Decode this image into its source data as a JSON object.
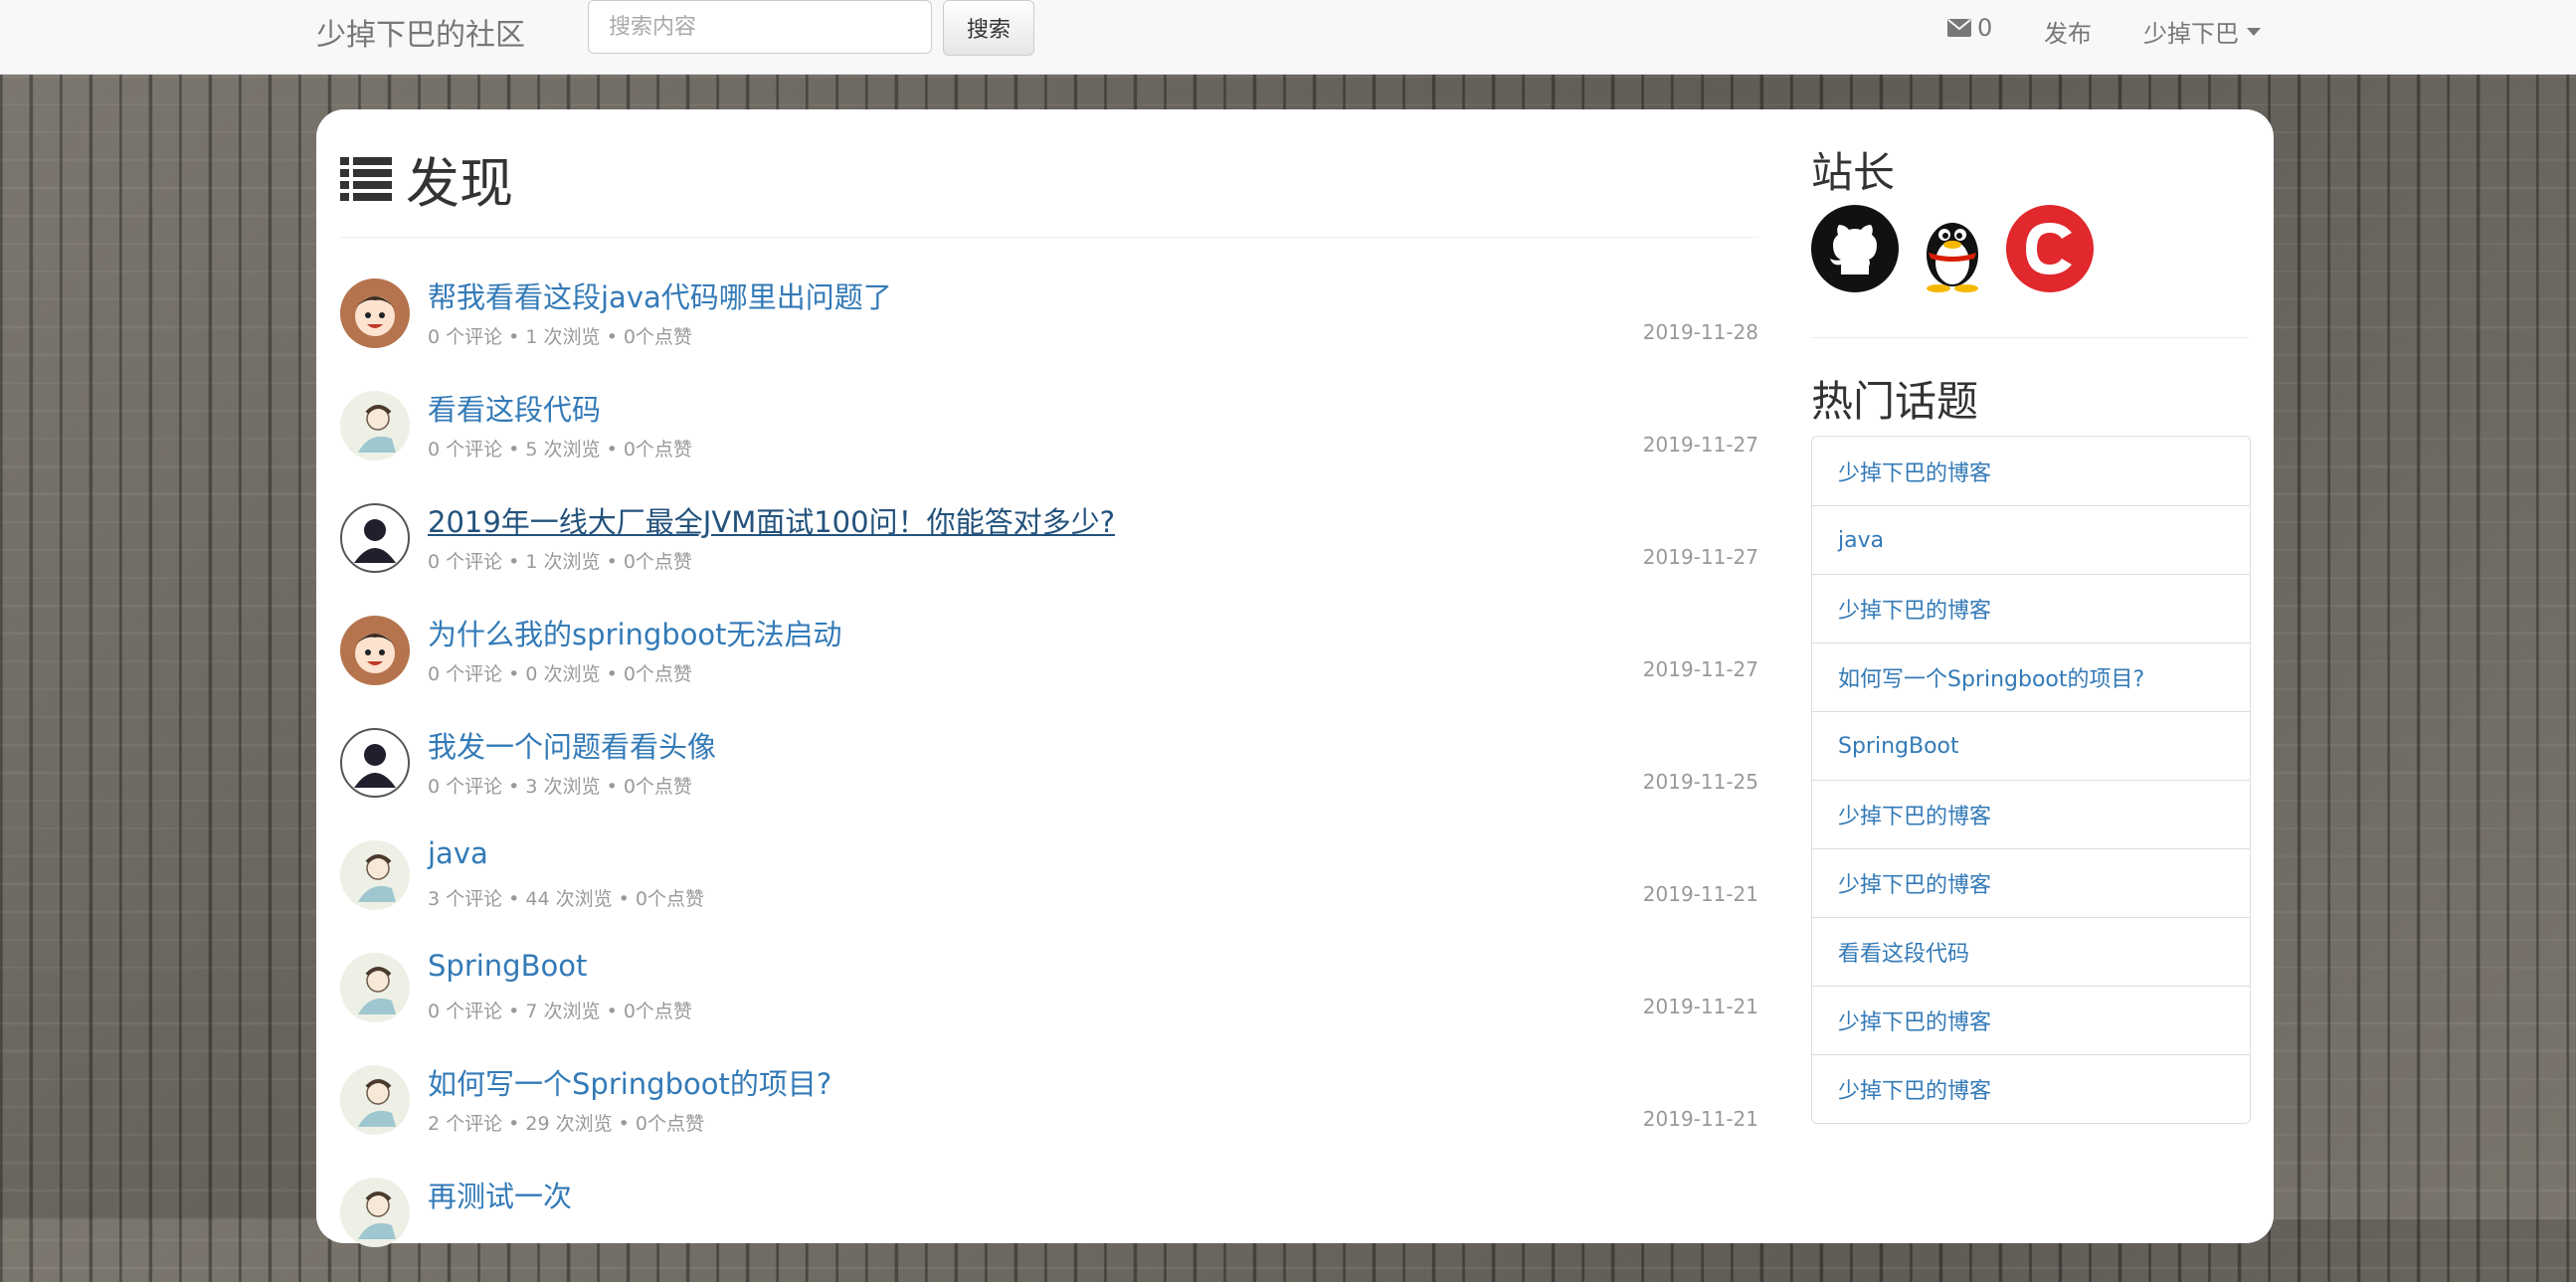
{
  "navbar": {
    "brand": "少掉下巴的社区",
    "search_placeholder": "搜索内容",
    "search_button": "搜索",
    "message_count": "0",
    "publish": "发布",
    "user": "少掉下巴"
  },
  "main": {
    "title": "发现",
    "questions": [
      {
        "title": "帮我看看这段java代码哪里出问题了",
        "meta": "0 个评论 • 1 次浏览 • 0个点赞",
        "date": "2019-11-28",
        "avatar": "cartoon-boy-avatar"
      },
      {
        "title": "看看这段代码",
        "meta": "0 个评论 • 5 次浏览 • 0个点赞",
        "date": "2019-11-27",
        "avatar": "sketch-person-avatar"
      },
      {
        "title": "2019年一线大厂最全JVM面试100问！你能答对多少?",
        "meta": "0 个评论 • 1 次浏览 • 0个点赞",
        "date": "2019-11-27",
        "avatar": "default-user-avatar"
      },
      {
        "title": "为什么我的springboot无法启动",
        "meta": "0 个评论 • 0 次浏览 • 0个点赞",
        "date": "2019-11-27",
        "avatar": "cartoon-boy-avatar"
      },
      {
        "title": "我发一个问题看看头像",
        "meta": "0 个评论 • 3 次浏览 • 0个点赞",
        "date": "2019-11-25",
        "avatar": "default-user-avatar"
      },
      {
        "title": "java",
        "meta": "3 个评论 • 44 次浏览 • 0个点赞",
        "date": "2019-11-21",
        "avatar": "sketch-person-avatar"
      },
      {
        "title": "SpringBoot",
        "meta": "0 个评论 • 7 次浏览 • 0个点赞",
        "date": "2019-11-21",
        "avatar": "sketch-person-avatar"
      },
      {
        "title": "如何写一个Springboot的项目?",
        "meta": "2 个评论 • 29 次浏览 • 0个点赞",
        "date": "2019-11-21",
        "avatar": "sketch-person-avatar"
      },
      {
        "title": "再测试一次",
        "meta": "",
        "date": "",
        "avatar": "sketch-person-avatar"
      }
    ]
  },
  "sidebar": {
    "owner_title": "站长",
    "socials": [
      "github-icon",
      "qq-penguin-icon",
      "csdn-icon"
    ],
    "hot_title": "热门话题",
    "topics": [
      "少掉下巴的博客",
      "java",
      "少掉下巴的博客",
      "如何写一个Springboot的项目?",
      "SpringBoot",
      "少掉下巴的博客",
      "少掉下巴的博客",
      "看看这段代码",
      "少掉下巴的博客",
      "少掉下巴的博客"
    ]
  },
  "colors": {
    "link": "#337ab7",
    "muted": "#999999",
    "csdn_red": "#e0282d"
  }
}
